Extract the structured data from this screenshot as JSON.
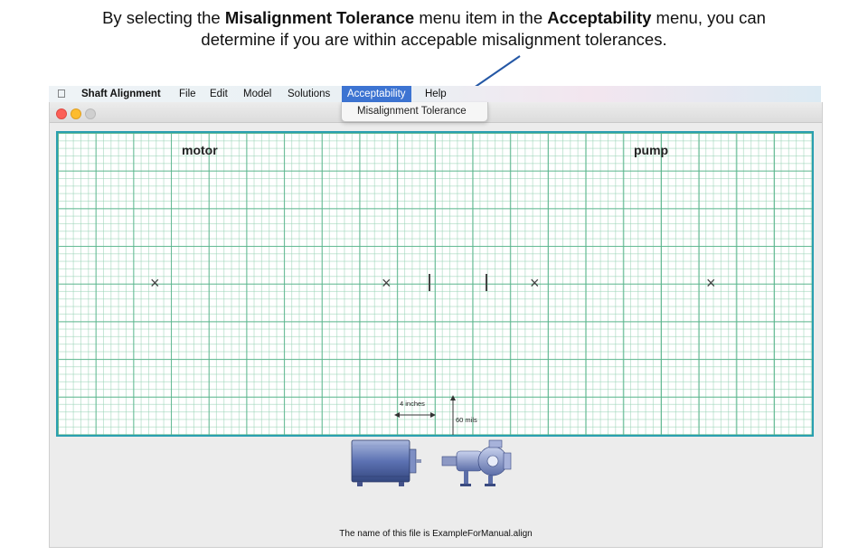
{
  "caption": {
    "line1_pre": "By selecting the ",
    "line1_bold1": "Misalignment Tolerance",
    "line1_mid": " menu item in the ",
    "line1_bold2": "Acceptability",
    "line1_post": " menu, you can",
    "line2": "determine if you are within accepable misalignment tolerances."
  },
  "menubar": {
    "apple_icon": "",
    "items": [
      "Shaft Alignment",
      "File",
      "Edit",
      "Model",
      "Solutions",
      "Acceptability",
      "Help"
    ],
    "active_item": "Acceptability"
  },
  "dropdown": {
    "items": [
      "Misalignment Tolerance"
    ]
  },
  "window": {
    "traffic_lights": [
      "close",
      "minimize",
      "zoom"
    ],
    "grid": {
      "labels": {
        "left": "motor",
        "right": "pump"
      },
      "marker_symbol": "×",
      "scale": {
        "horizontal": "4 inches",
        "vertical": "60 mils"
      }
    },
    "footer": "The name of this file is ExampleForManual.align"
  },
  "colors": {
    "grid_border": "#2a9fb0",
    "grid_major": "#58b48c",
    "grid_minor": "#96d2b4",
    "menu_highlight": "#3d74d2",
    "annotation_arrow": "#2457a5"
  }
}
